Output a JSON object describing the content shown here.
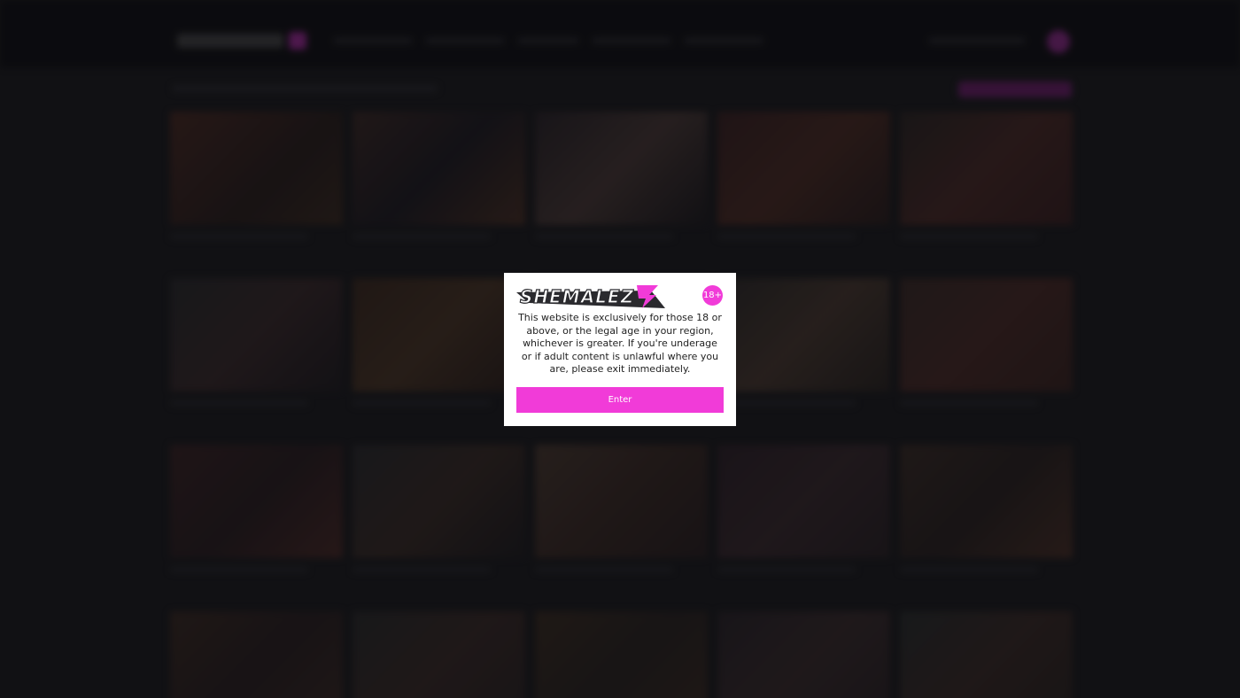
{
  "modal": {
    "logo_text": "SHEMALEZ",
    "age_badge": "18+",
    "message": "This website is exclusively for those 18 or above, or the legal age in your region, whichever is greater. If you're underage or if adult content is unlawful where you are, please exit immediately.",
    "enter_label": "Enter"
  },
  "colors": {
    "accent": "#f13bd8",
    "header_bg": "#0f0f12",
    "page_bg": "#1b1b1d",
    "modal_bg": "#ffffff"
  }
}
